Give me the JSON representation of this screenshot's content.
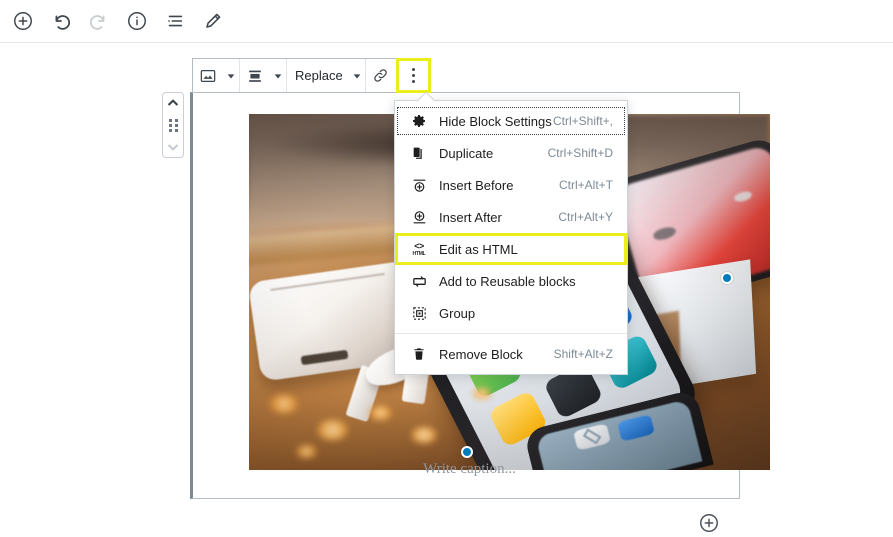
{
  "header": {
    "buttons": [
      {
        "name": "add-block-icon",
        "label": "Add block",
        "state": "enabled"
      },
      {
        "name": "undo-icon",
        "label": "Undo",
        "state": "enabled"
      },
      {
        "name": "redo-icon",
        "label": "Redo",
        "state": "disabled"
      },
      {
        "name": "content-info-icon",
        "label": "Content structure",
        "state": "enabled"
      },
      {
        "name": "list-view-icon",
        "label": "Block navigation",
        "state": "enabled"
      },
      {
        "name": "edit-pencil-icon",
        "label": "Edit",
        "state": "enabled"
      }
    ]
  },
  "block_toolbar": {
    "block_type_label": "Image",
    "align_label": "Align",
    "replace_label": "Replace",
    "link_label": "Link",
    "more_options_label": "More options",
    "highlighted": "more-options-button",
    "highlight_color": "#eded1a"
  },
  "mover": {
    "up_label": "Move up",
    "drag_label": "Drag",
    "down_label": "Move down"
  },
  "image_block": {
    "caption_placeholder": "Write caption...",
    "alt_description": "AirPods case with earbuds and an iPhone on a wooden desk with warm bokeh lights, iPhone box in the background",
    "handle_color": "#007cba"
  },
  "more_menu": {
    "groups": [
      {
        "items": [
          {
            "icon": "gear-icon",
            "label": "Hide Block Settings",
            "shortcut": "Ctrl+Shift+,",
            "state": "focused"
          },
          {
            "icon": "duplicate-icon",
            "label": "Duplicate",
            "shortcut": "Ctrl+Shift+D",
            "state": "normal"
          },
          {
            "icon": "insert-before-icon",
            "label": "Insert Before",
            "shortcut": "Ctrl+Alt+T",
            "state": "normal"
          },
          {
            "icon": "insert-after-icon",
            "label": "Insert After",
            "shortcut": "Ctrl+Alt+Y",
            "state": "normal"
          },
          {
            "icon": "html-icon",
            "label": "Edit as HTML",
            "shortcut": "",
            "state": "highlighted"
          },
          {
            "icon": "reusable-block-icon",
            "label": "Add to Reusable blocks",
            "shortcut": "",
            "state": "normal"
          },
          {
            "icon": "group-icon",
            "label": "Group",
            "shortcut": "",
            "state": "normal"
          }
        ]
      },
      {
        "items": [
          {
            "icon": "trash-icon",
            "label": "Remove Block",
            "shortcut": "Shift+Alt+Z",
            "state": "normal"
          }
        ]
      }
    ]
  },
  "appender": {
    "label": "Add block",
    "icon": "plus-circle-icon"
  }
}
